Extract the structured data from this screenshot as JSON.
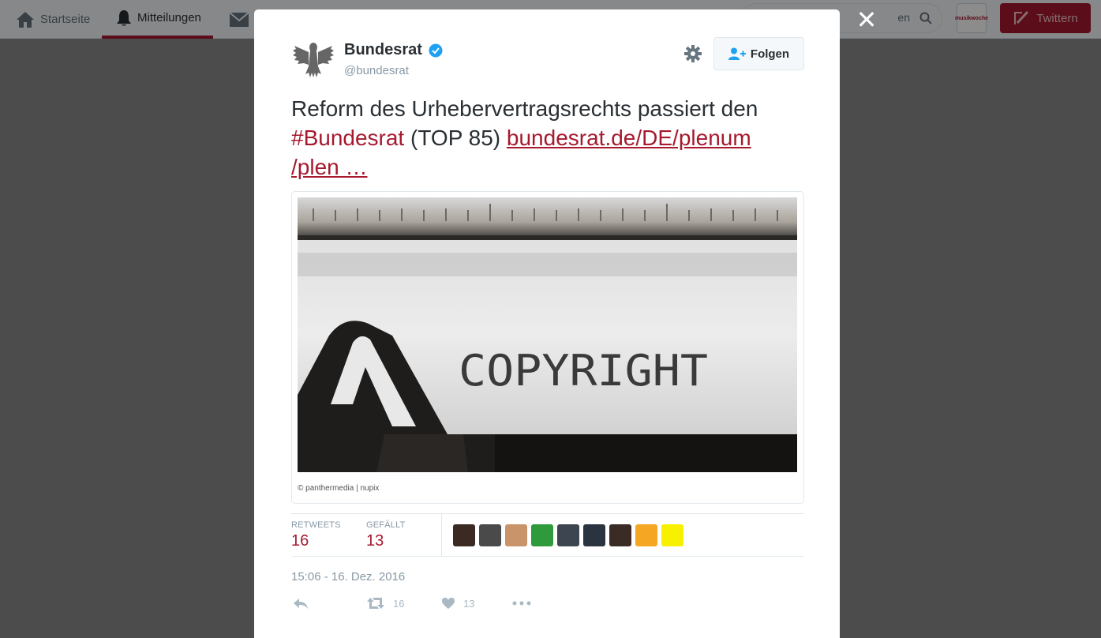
{
  "nav": {
    "items": [
      {
        "label": "Startseite",
        "icon": "home-icon"
      },
      {
        "label": "Mitteilungen",
        "icon": "bell-icon",
        "active": true
      },
      {
        "label": "",
        "icon": "envelope-icon"
      }
    ],
    "search_value": "en",
    "profile_badge": "musikwoche",
    "tweet_button": "Twittern",
    "accent_color": "#a6192e"
  },
  "tweet": {
    "author_name": "Bundesrat",
    "author_handle": "@bundesrat",
    "follow_label": "Folgen",
    "text_part1": "Reform des Urhebervertragsrechts passiert den ",
    "hashtag": "#Bundesrat",
    "text_part2": " (TOP 85) ",
    "link_line1": "bundesrat.de/DE/plenum",
    "link_line2": "/plen …",
    "image_word": "COPYRIGHT",
    "image_caption": "© panthermedia | nupix",
    "retweets_label": "RETWEETS",
    "retweets_count": "16",
    "likes_label": "GEFÄLLT",
    "likes_count": "13",
    "timestamp": "15:06 - 16. Dez. 2016",
    "action_retweet_count": "16",
    "action_like_count": "13"
  },
  "likers": [
    {
      "color": "#3a2a22"
    },
    {
      "color": "#4a4a4a"
    },
    {
      "color": "#c9946a"
    },
    {
      "color": "#2f9a3c"
    },
    {
      "color": "#3d4650"
    },
    {
      "color": "#2a3340"
    },
    {
      "color": "#3a2c24"
    },
    {
      "color": "#f5a623"
    },
    {
      "color": "#f7f000"
    }
  ]
}
